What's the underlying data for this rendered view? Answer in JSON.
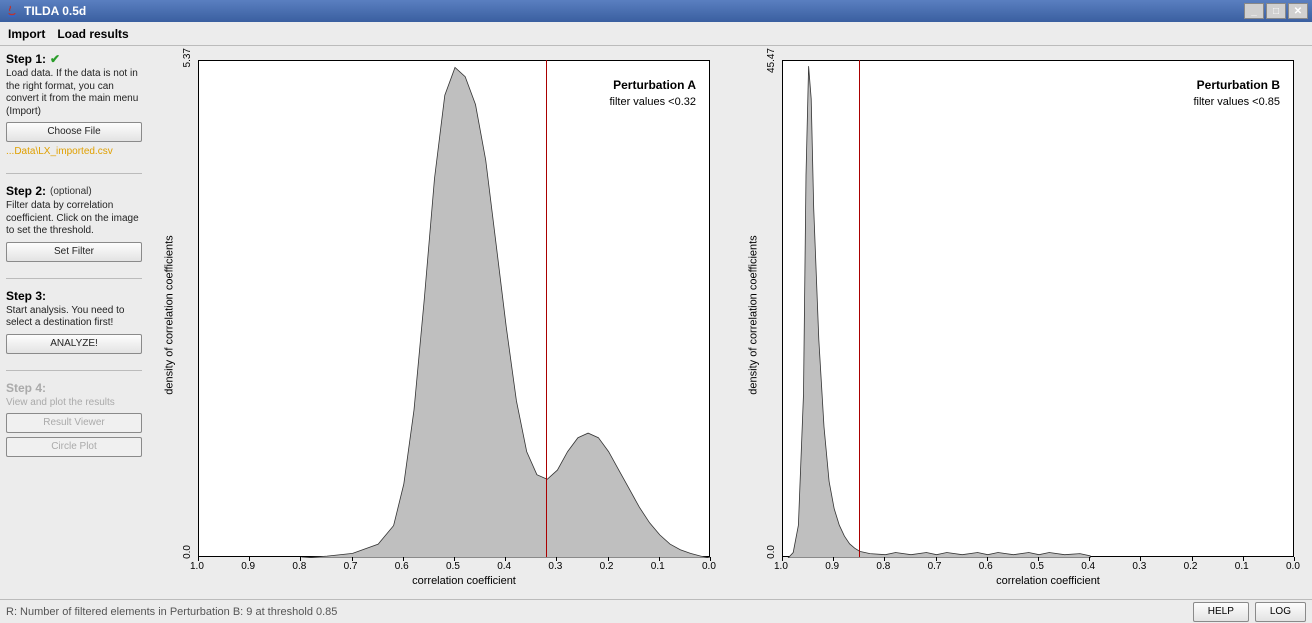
{
  "window": {
    "title": "TILDA 0.5d"
  },
  "menu": {
    "import": "Import",
    "load_results": "Load results"
  },
  "steps": {
    "s1": {
      "title": "Step 1:",
      "text": "Load data. If the data is not in the right format, you can convert it from the main menu (Import)",
      "button": "Choose File",
      "file": "...Data\\LX_imported.csv"
    },
    "s2": {
      "title": "Step 2:",
      "note": "(optional)",
      "text": "Filter data by correlation coefficient. Click on the image to set the threshold.",
      "button": "Set Filter"
    },
    "s3": {
      "title": "Step 3:",
      "text": "Start analysis. You need to select a destination first!",
      "button": "ANALYZE!"
    },
    "s4": {
      "title": "Step 4:",
      "text": "View and plot the results",
      "button1": "Result Viewer",
      "button2": "Circle Plot"
    }
  },
  "chart_data": [
    {
      "type": "area",
      "title": "Perturbation A",
      "subtitle": "filter values <0.32",
      "xlabel": "correlation coefficient",
      "ylabel": "density of correlation coefficients",
      "xlim": [
        1.0,
        0.0
      ],
      "ylim": [
        0.0,
        5.37
      ],
      "threshold": 0.32,
      "xticks": [
        "1.0",
        "0.9",
        "0.8",
        "0.7",
        "0.6",
        "0.5",
        "0.4",
        "0.3",
        "0.2",
        "0.1",
        "0.0"
      ],
      "yticks": [
        "0.0",
        "5.37"
      ],
      "x": [
        0.8,
        0.75,
        0.7,
        0.65,
        0.62,
        0.6,
        0.58,
        0.56,
        0.54,
        0.52,
        0.5,
        0.48,
        0.46,
        0.44,
        0.42,
        0.4,
        0.38,
        0.36,
        0.34,
        0.32,
        0.3,
        0.28,
        0.26,
        0.24,
        0.22,
        0.2,
        0.18,
        0.16,
        0.14,
        0.12,
        0.1,
        0.08,
        0.06,
        0.04,
        0.02,
        0.0
      ],
      "values": [
        0.0,
        0.02,
        0.05,
        0.15,
        0.35,
        0.8,
        1.6,
        2.8,
        4.1,
        5.0,
        5.3,
        5.2,
        4.9,
        4.3,
        3.4,
        2.5,
        1.7,
        1.15,
        0.9,
        0.85,
        0.95,
        1.15,
        1.3,
        1.35,
        1.3,
        1.15,
        0.95,
        0.75,
        0.55,
        0.38,
        0.25,
        0.15,
        0.09,
        0.05,
        0.02,
        0.0
      ]
    },
    {
      "type": "area",
      "title": "Perturbation B",
      "subtitle": "filter values <0.85",
      "xlabel": "correlation coefficient",
      "ylabel": "density of correlation coefficients",
      "xlim": [
        1.0,
        0.0
      ],
      "ylim": [
        0.0,
        45.47
      ],
      "threshold": 0.85,
      "xticks": [
        "1.0",
        "0.9",
        "0.8",
        "0.7",
        "0.6",
        "0.5",
        "0.4",
        "0.3",
        "0.2",
        "0.1",
        "0.0"
      ],
      "yticks": [
        "0.0",
        "45.47"
      ],
      "x": [
        0.99,
        0.98,
        0.97,
        0.96,
        0.955,
        0.95,
        0.945,
        0.94,
        0.93,
        0.92,
        0.91,
        0.9,
        0.89,
        0.88,
        0.87,
        0.86,
        0.85,
        0.83,
        0.8,
        0.78,
        0.75,
        0.72,
        0.7,
        0.68,
        0.65,
        0.62,
        0.6,
        0.58,
        0.55,
        0.52,
        0.5,
        0.48,
        0.45,
        0.42,
        0.4
      ],
      "values": [
        0.0,
        0.5,
        3.0,
        15.0,
        35.0,
        45.0,
        42.0,
        32.0,
        20.0,
        12.0,
        7.0,
        4.5,
        3.0,
        2.0,
        1.3,
        0.9,
        0.6,
        0.4,
        0.3,
        0.5,
        0.3,
        0.5,
        0.3,
        0.5,
        0.3,
        0.5,
        0.3,
        0.5,
        0.3,
        0.5,
        0.3,
        0.5,
        0.3,
        0.4,
        0.2
      ]
    }
  ],
  "status": {
    "text": "R: Number of filtered elements in Perturbation B: 9 at threshold 0.85",
    "help": "HELP",
    "log": "LOG"
  }
}
